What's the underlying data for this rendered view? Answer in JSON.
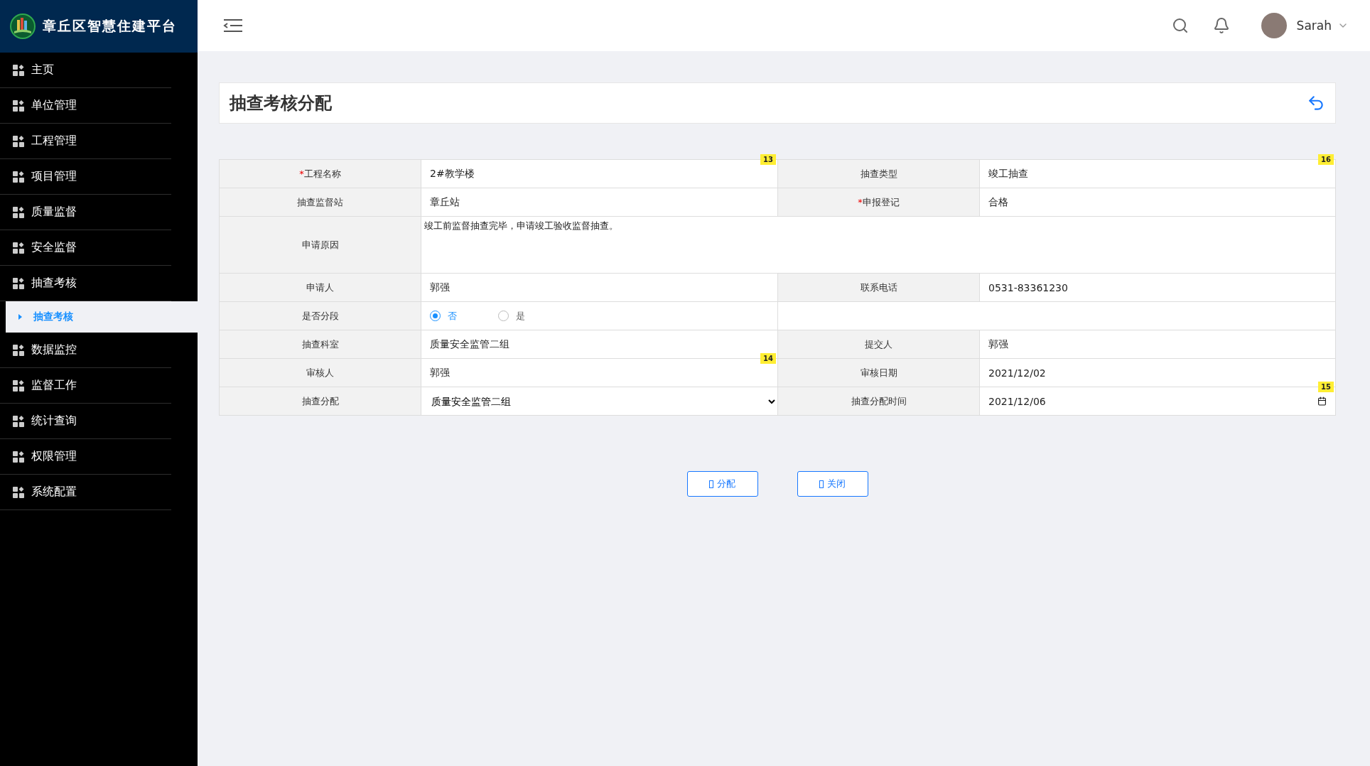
{
  "brand": {
    "title": "章丘区智慧住建平台"
  },
  "sidebar": {
    "items": [
      {
        "label": "主页",
        "selected": false
      },
      {
        "label": "单位管理",
        "selected": false
      },
      {
        "label": "工程管理",
        "selected": false
      },
      {
        "label": "项目管理",
        "selected": false
      },
      {
        "label": "质量监督",
        "selected": false
      },
      {
        "label": "安全监督",
        "selected": false
      },
      {
        "label": "抽查考核",
        "selected": false,
        "children": [
          {
            "label": "抽查考核",
            "selected": true
          }
        ]
      },
      {
        "label": "数据监控",
        "selected": false
      },
      {
        "label": "监督工作",
        "selected": false
      },
      {
        "label": "统计查询",
        "selected": false
      },
      {
        "label": "权限管理",
        "selected": false
      },
      {
        "label": "系统配置",
        "selected": false
      }
    ]
  },
  "header": {
    "user": "Sarah"
  },
  "page": {
    "title": "抽查考核分配"
  },
  "form": {
    "rows": [
      {
        "fields": [
          {
            "label": "工程名称",
            "mark": "*",
            "kind": "text",
            "value": "2#教学楼",
            "badge": "13"
          },
          {
            "label": "抽查类型",
            "kind": "text",
            "value": "竣工抽查",
            "badge": "16"
          }
        ]
      },
      {
        "fields": [
          {
            "label": "抽查监督站",
            "kind": "text",
            "value": "章丘站"
          },
          {
            "label": "申报登记",
            "mark": "*",
            "kind": "text",
            "value": "合格"
          }
        ]
      },
      {
        "fields": [
          {
            "label": "申请原因",
            "kind": "textarea",
            "value": "竣工前监督抽查完毕，申请竣工验收监督抽查。"
          }
        ]
      },
      {
        "fields": [
          {
            "label": "申请人",
            "kind": "text",
            "value": "郭强"
          },
          {
            "label": "联系电话",
            "kind": "text",
            "value": "0531-83361230"
          }
        ]
      },
      {
        "fields": [
          {
            "label": "是否分段",
            "kind": "radio",
            "options": [
              {
                "label": "否",
                "selected": true
              },
              {
                "label": "是",
                "selected": false
              }
            ]
          },
          {
            "kind": "empty"
          }
        ]
      },
      {
        "fields": [
          {
            "label": "抽查科室",
            "kind": "text",
            "value": "质量安全监管二组"
          },
          {
            "label": "提交人",
            "kind": "text",
            "value": "郭强"
          }
        ]
      },
      {
        "fields": [
          {
            "label": "审核人",
            "kind": "text",
            "value": "郭强",
            "badge": "14"
          },
          {
            "label": "审核日期",
            "kind": "text",
            "value": "2021/12/02"
          }
        ]
      },
      {
        "fields": [
          {
            "label": "抽查分配",
            "kind": "select",
            "value": "质量安全监管二组"
          },
          {
            "label": "抽查分配时间",
            "kind": "date",
            "value": "2021/12/06",
            "badge": "15"
          }
        ]
      }
    ]
  },
  "buttons": [
    {
      "label": "分配"
    },
    {
      "label": "关闭"
    }
  ]
}
